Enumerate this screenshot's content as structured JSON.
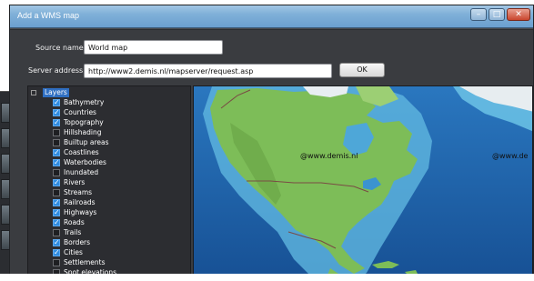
{
  "window": {
    "title": "Add a WMS map",
    "minimize_icon": "minimize-icon",
    "maximize_icon": "maximize-icon",
    "close_icon": "close-icon"
  },
  "form": {
    "source_name_label": "Source name",
    "source_name_value": "World map",
    "server_address_label": "Server address:",
    "server_address_value": "http://www2.demis.nl/mapserver/request.asp",
    "ok_label": "OK"
  },
  "layers": {
    "root": {
      "label": "Layers"
    },
    "items": [
      {
        "label": "Bathymetry",
        "checked": true
      },
      {
        "label": "Countries",
        "checked": true
      },
      {
        "label": "Topography",
        "checked": true
      },
      {
        "label": "Hillshading",
        "checked": false
      },
      {
        "label": "Builtup areas",
        "checked": false
      },
      {
        "label": "Coastlines",
        "checked": true
      },
      {
        "label": "Waterbodies",
        "checked": true
      },
      {
        "label": "Inundated",
        "checked": false
      },
      {
        "label": "Rivers",
        "checked": true
      },
      {
        "label": "Streams",
        "checked": false
      },
      {
        "label": "Railroads",
        "checked": true
      },
      {
        "label": "Highways",
        "checked": true
      },
      {
        "label": "Roads",
        "checked": true
      },
      {
        "label": "Trails",
        "checked": false
      },
      {
        "label": "Borders",
        "checked": true
      },
      {
        "label": "Cities",
        "checked": true
      },
      {
        "label": "Settlements",
        "checked": false
      },
      {
        "label": "Spot elevations",
        "checked": false
      }
    ]
  },
  "map": {
    "watermark_1": "@www.demis.nl",
    "watermark_2": "@www.de",
    "colors": {
      "ocean": "#1b5ea4",
      "shallow": "#6cc3e6",
      "land": "#7fbf5a",
      "ice": "#e8eef2"
    }
  }
}
